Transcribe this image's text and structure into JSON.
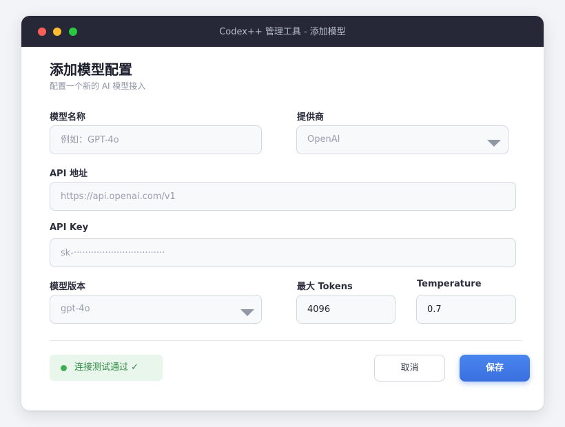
{
  "window": {
    "title": "Codex++ 管理工具 - 添加模型"
  },
  "header": {
    "title": "添加模型配置",
    "subtitle": "配置一个新的 AI 模型接入"
  },
  "form": {
    "model_name": {
      "label": "模型名称",
      "placeholder": "例如：GPT-4o"
    },
    "provider": {
      "label": "提供商",
      "value": "OpenAI"
    },
    "api_url": {
      "label": "API 地址",
      "placeholder": "https://api.openai.com/v1"
    },
    "api_key": {
      "label": "API Key",
      "placeholder": "sk-································"
    },
    "model_version": {
      "label": "模型版本",
      "value": "gpt-4o"
    },
    "max_tokens": {
      "label": "最大 Tokens",
      "value": "4096"
    },
    "temperature": {
      "label": "Temperature",
      "value": "0.7"
    }
  },
  "footer": {
    "status_text": "连接测试通过 ✓",
    "cancel_label": "取消",
    "save_label": "保存"
  },
  "colors": {
    "titlebar": "#262737",
    "accent": "#3a6fe0",
    "success": "#3fae52"
  },
  "icons": {
    "status": "status-dot-icon",
    "select": "chevron-down-icon"
  }
}
